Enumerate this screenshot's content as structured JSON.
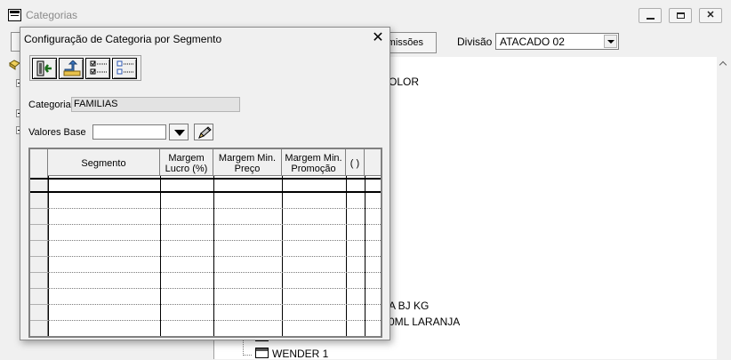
{
  "parent_window": {
    "title": "Categorias",
    "toolbar": {
      "permissions_button": "rmissões",
      "division_label": "Divisão",
      "division_value": "ATACADO 02"
    },
    "tree_fragments": [
      "OLOR",
      "A BJ KG",
      "0ML LARANJA",
      "WENDER 1"
    ]
  },
  "dialog": {
    "title": "Configuração de Categoria por Segmento",
    "toolbar": {
      "buttons": [
        {
          "name": "exit-icon"
        },
        {
          "name": "save-icon"
        },
        {
          "name": "check-all-icon"
        },
        {
          "name": "uncheck-all-icon"
        }
      ]
    },
    "categoria_label": "Categoria",
    "categoria_value": "FAMILIAS",
    "valores_base_label": "Valores Base",
    "valores_base_value": "",
    "grid": {
      "columns": [
        {
          "label": "Segmento"
        },
        {
          "label": "Margem\nLucro (%)"
        },
        {
          "label": "Margem Min.\nPreço"
        },
        {
          "label": "Margem Min.\nPromoção"
        },
        {
          "label": "( )"
        }
      ],
      "rows": [
        [
          "",
          "",
          "",
          "",
          ""
        ],
        [
          "",
          "",
          "",
          "",
          ""
        ],
        [
          "",
          "",
          "",
          "",
          ""
        ],
        [
          "",
          "",
          "",
          "",
          ""
        ],
        [
          "",
          "",
          "",
          "",
          ""
        ],
        [
          "",
          "",
          "",
          "",
          ""
        ],
        [
          "",
          "",
          "",
          "",
          ""
        ],
        [
          "",
          "",
          "",
          "",
          ""
        ],
        [
          "",
          "",
          "",
          "",
          ""
        ],
        [
          "",
          "",
          "",
          "",
          ""
        ]
      ]
    }
  },
  "colors": {
    "window_bg": "#f0f0f0",
    "disabled_title": "#8a8a8a",
    "readonly_field": "#e3e3e3"
  }
}
